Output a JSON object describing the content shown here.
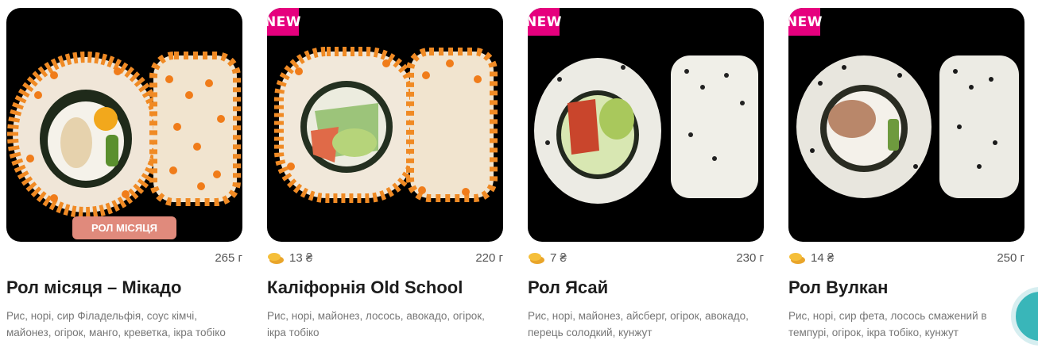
{
  "cards": [
    {
      "badge": "",
      "promo_label": "РОЛ МІСЯЦЯ",
      "bonus": "",
      "weight": "265 г",
      "title": "Рол місяця – Мікадо",
      "description": "Рис, норі, сир Філадельфія, соус кімчі, майонез, огірок, манго, креветка, ікра тобіко"
    },
    {
      "badge": "NEW",
      "promo_label": "",
      "bonus": "13 ₴",
      "weight": "220 г",
      "title": "Каліфорнія Old School",
      "description": "Рис, норі, майонез, лосось, авокадо, огірок, ікра тобіко"
    },
    {
      "badge": "NEW",
      "promo_label": "",
      "bonus": "7 ₴",
      "weight": "230 г",
      "title": "Рол Ясай",
      "description": "Рис, норі, майонез, айсберг, огірок, авокадо, перець солодкий, кунжут"
    },
    {
      "badge": "NEW",
      "promo_label": "",
      "bonus": "14 ₴",
      "weight": "250 г",
      "title": "Рол Вулкан",
      "description": "Рис, норі, сир фета, лосось смажений в темпурі, огірок, ікра тобіко, кунжут"
    }
  ],
  "colors": {
    "new_badge": "#e6007e",
    "promo_badge": "#e08a7c",
    "chat_button": "#39b6b9"
  },
  "icons": {
    "bonus": "coin-stack-icon",
    "chat": "chat-bubble-icon"
  }
}
